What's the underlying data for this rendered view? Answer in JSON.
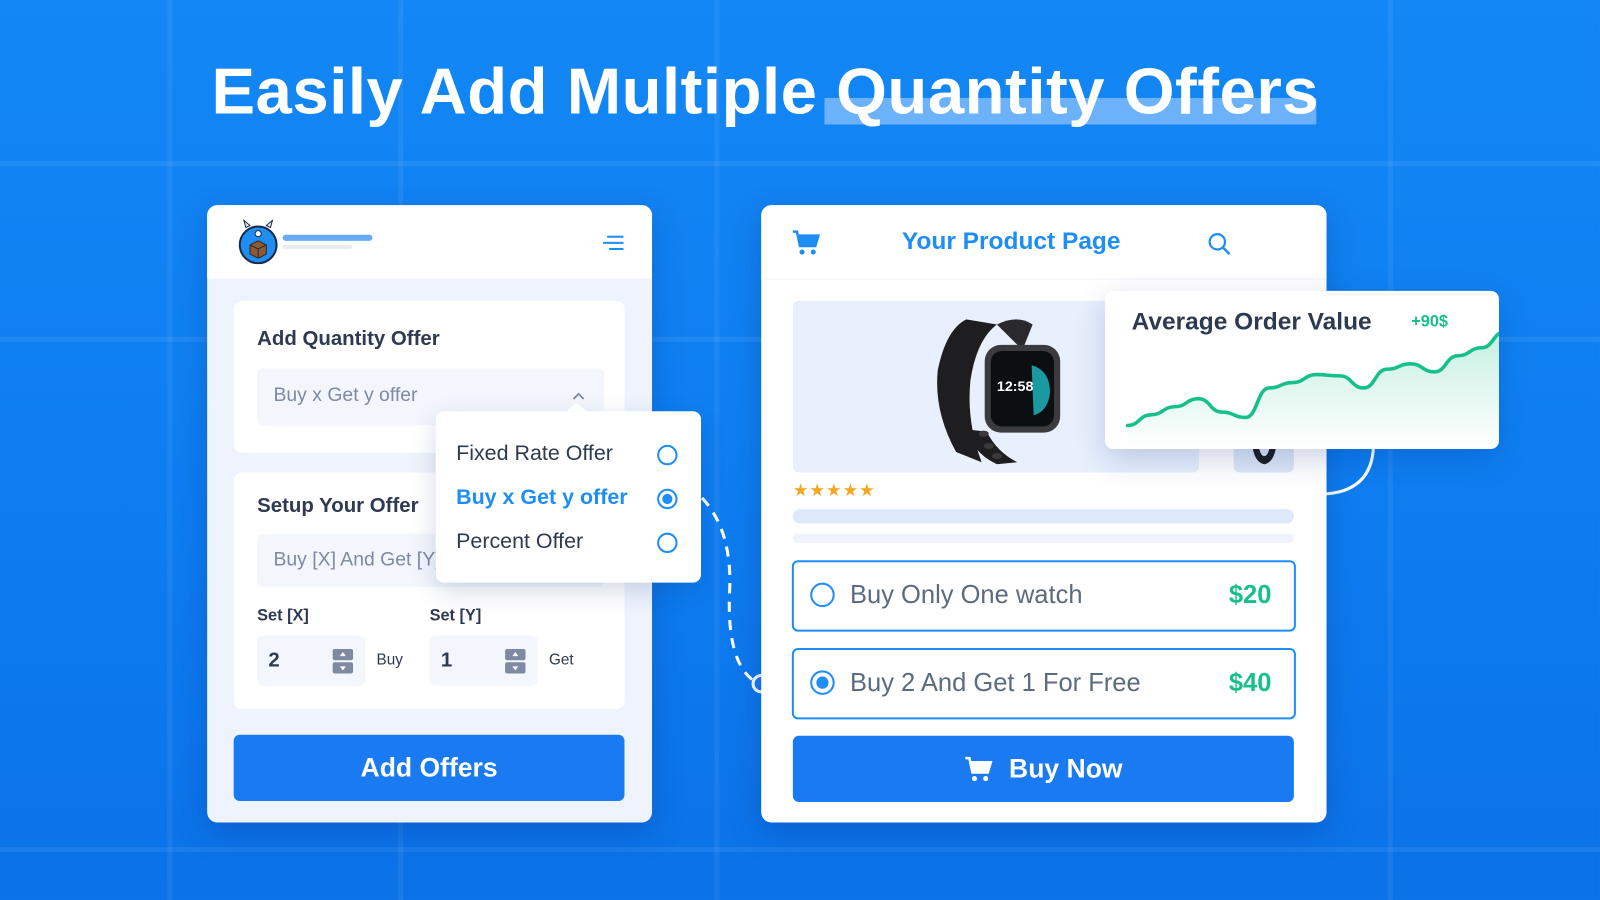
{
  "headline": "Easily Add Multiple Quantity Offers",
  "colors": {
    "background": "#0d7cf0",
    "accent": "#1a7af1",
    "accent_light": "#1e8ef5",
    "price_green": "#17c08b",
    "star": "#f5a623",
    "text_dark": "#2d3a52"
  },
  "admin_panel": {
    "logo": "monster-box-logo",
    "menu_icon": "hamburger-menu-icon",
    "add_offer_section": {
      "title": "Add Quantity Offer",
      "select_value": "Buy x Get y offer"
    },
    "setup_section": {
      "title": "Setup Your Offer",
      "field_value": "Buy [X] And Get [Y]",
      "set_x": {
        "label": "Set [X]",
        "value": "2",
        "unit": "Buy"
      },
      "set_y": {
        "label": "Set [Y]",
        "value": "1",
        "unit": "Get"
      }
    },
    "add_offers_button": "Add Offers"
  },
  "offer_dropdown": {
    "options": [
      {
        "label": "Fixed Rate Offer",
        "selected": false
      },
      {
        "label": "Buy x Get y offer",
        "selected": true
      },
      {
        "label": "Percent Offer",
        "selected": false
      }
    ]
  },
  "product_page": {
    "title": "Your Product Page",
    "watch_time": "12:58",
    "rating": "★★★★★",
    "rating_value": 5,
    "options": [
      {
        "label": "Buy Only One watch",
        "price": "$20",
        "selected": false
      },
      {
        "label": "Buy 2 And Get 1 For Free",
        "price": "$40",
        "selected": true
      }
    ],
    "buy_now_button": "Buy Now"
  },
  "aov_card": {
    "title": "Average Order Value",
    "delta": "+90$",
    "trend": [
      10,
      18,
      24,
      30,
      20,
      16,
      38,
      42,
      48,
      47,
      38,
      52,
      56,
      50,
      62,
      68,
      80
    ]
  }
}
